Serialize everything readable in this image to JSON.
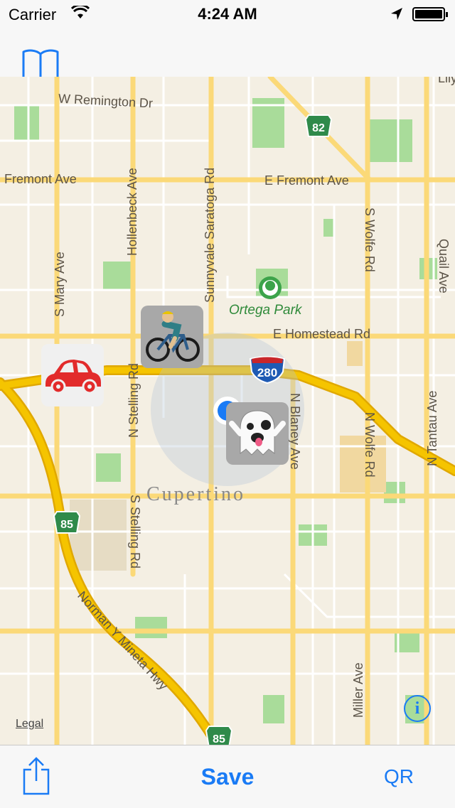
{
  "status_bar": {
    "carrier": "Carrier",
    "time": "4:24 AM"
  },
  "nav": {
    "bookmarks_icon": "book-icon"
  },
  "map": {
    "streets": {
      "w_remington": "W Remington Dr",
      "fremont_w": "Fremont Ave",
      "fremont_e": "E Fremont Ave",
      "homestead": "E Homestead Rd",
      "s_mary": "S Mary Ave",
      "hollenbeck": "Hollenbeck Ave",
      "saratoga": "Sunnyvale Saratoga Rd",
      "s_wolfe": "S Wolfe Rd",
      "quail": "Quail Ave",
      "n_stelling": "N Stelling Rd",
      "s_stelling": "S Stelling Rd",
      "n_blaney": "N Blaney Ave",
      "n_wolfe": "N Wolfe Rd",
      "n_tantau": "N Tantau Ave",
      "miller": "Miller Ave",
      "norman": "Norman Y Mineta Hwy",
      "lily": "Lily"
    },
    "park": "Ortega Park",
    "city": "Cupertino",
    "shields": {
      "i280": "280",
      "h85_a": "85",
      "h85_b": "85",
      "h82": "82"
    },
    "pins": {
      "bike": "cyclist",
      "car": "car",
      "ghost": "ghost"
    },
    "legal": "Legal",
    "info": "i"
  },
  "toolbar": {
    "share_icon": "share-icon",
    "save_label": "Save",
    "qr_label": "QR"
  },
  "colors": {
    "accent": "#1a7bf5",
    "highway": "#f5c400",
    "road": "#fbd978",
    "park": "#a9dc9a"
  }
}
